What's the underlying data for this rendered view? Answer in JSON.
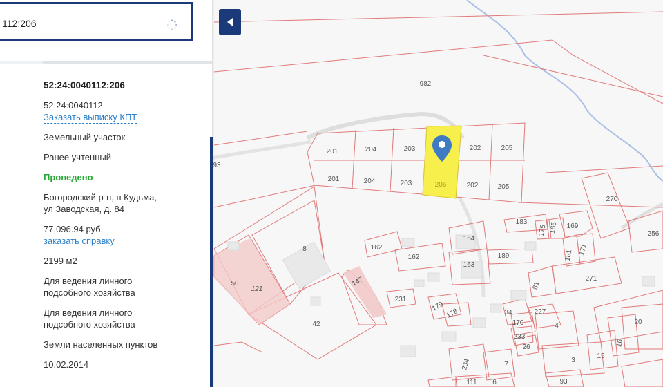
{
  "search": {
    "value": "112:206"
  },
  "panel": {
    "cadastral_number": "52:24:0040112:206",
    "quarter": "52:24:0040112",
    "order_kpt_link": "Заказать выписку КПТ",
    "object_type": "Земельный участок",
    "status": "Ранее учтенный",
    "survey_status": "Проведено",
    "address_line1": "Богородский р-н, п Кудьма,",
    "address_line2": "ул Заводская, д. 84",
    "cadastral_value": "77,096.94 руб.",
    "order_reference_link": "заказать справку",
    "area": "2199 м2",
    "permitted_use_1_line1": "Для ведения личного",
    "permitted_use_1_line2": "подсобного хозяйства",
    "permitted_use_2_line1": "Для ведения личного",
    "permitted_use_2_line2": "подсобного хозяйства",
    "land_category": "Земли населенных пунктов",
    "date": "10.02.2014"
  },
  "map": {
    "labels": {
      "l982": "982",
      "l93": "93",
      "l201a": "201",
      "l204a": "204",
      "l203a": "203",
      "l202a": "202",
      "l205a": "205",
      "l201b": "201",
      "l204b": "204",
      "l203b": "203",
      "l206": "206",
      "l202b": "202",
      "l205b": "205",
      "l270": "270",
      "l183": "183",
      "l175": "175",
      "l165": "165",
      "l169": "169",
      "l256": "256",
      "l162a": "162",
      "l164": "164",
      "l171": "171",
      "l162b": "162",
      "l189": "189",
      "l181": "181",
      "l163": "163",
      "l8": "8",
      "l50": "50",
      "l121": "121",
      "l271": "271",
      "l81": "81",
      "l147": "147",
      "l231": "231",
      "l179": "179",
      "l178": "178",
      "l42": "42",
      "l227": "227",
      "l34": "34",
      "l170": "170",
      "l4": "4",
      "l233": "233",
      "l26": "26",
      "l20": "20",
      "l16": "16",
      "l3": "3",
      "l15": "15",
      "l234": "234",
      "l7": "7",
      "l111": "111",
      "l6": "6",
      "l93b": "93"
    },
    "selected_color": "#f7ef4b",
    "boundary_color": "#e07a7a"
  },
  "collapse_icon": "chevron-left-icon",
  "pin_icon": "map-pin-icon",
  "spinner_icon": "loading-spinner-icon"
}
